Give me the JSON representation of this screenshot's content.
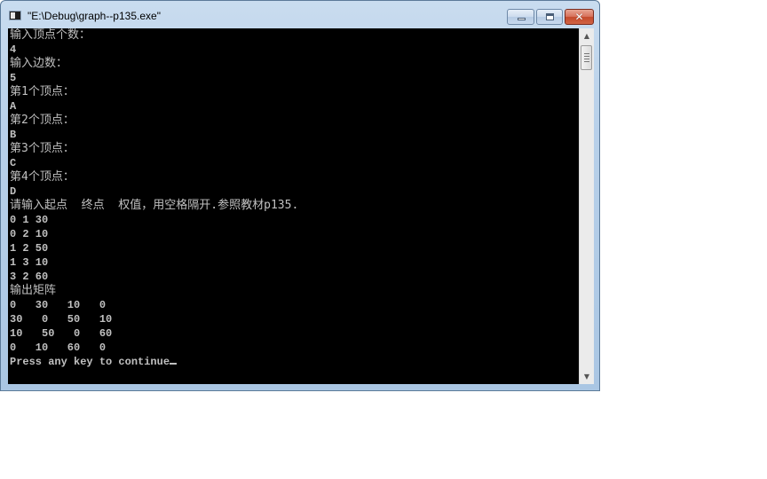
{
  "window": {
    "title": "\"E:\\Debug\\graph--p135.exe\"",
    "icon": "console-app-icon",
    "buttons": {
      "minimize": "minimize-icon",
      "maximize": "maximize-icon",
      "close": "close-icon",
      "close_glyph": "✕"
    }
  },
  "console": {
    "lines": [
      "输入顶点个数：",
      "4",
      "输入边数：",
      "5",
      "第1个顶点：",
      "A",
      "第2个顶点：",
      "B",
      "第3个顶点：",
      "C",
      "第4个顶点：",
      "D",
      "请输入起点  终点  权值，用空格隔开.参照教材p135.",
      "0 1 30",
      "0 2 10",
      "1 2 50",
      "1 3 10",
      "3 2 60",
      "输出矩阵",
      "0   30   10   0",
      "30   0   50   10",
      "10   50   0   60",
      "0   10   60   0",
      "Press any key to continue"
    ],
    "colors": {
      "background": "#000000",
      "foreground": "#c0c0c0"
    }
  },
  "scrollbar": {
    "up_arrow": "▲",
    "down_arrow": "▼",
    "position": 0
  }
}
